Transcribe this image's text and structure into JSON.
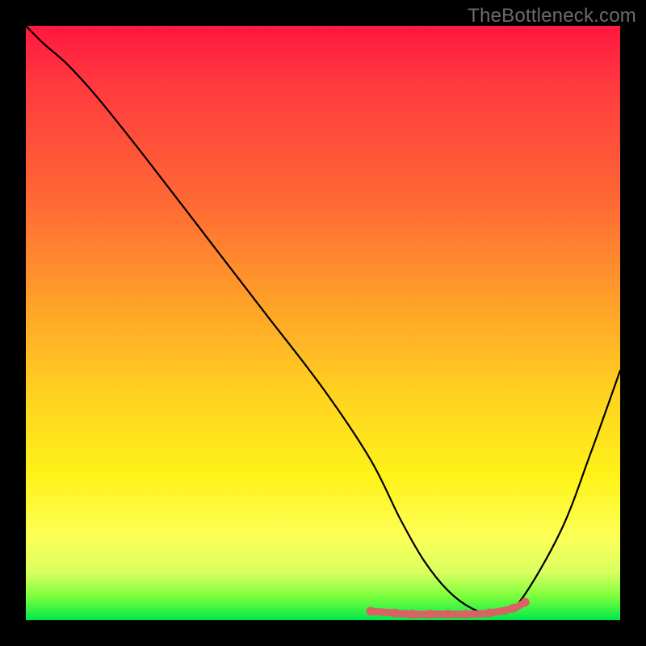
{
  "watermark": "TheBottleneck.com",
  "chart_data": {
    "type": "line",
    "title": "",
    "xlabel": "",
    "ylabel": "",
    "xlim": [
      0,
      100
    ],
    "ylim": [
      0,
      100
    ],
    "grid": false,
    "legend": false,
    "colors": {
      "gradient_top": "#ff173f",
      "gradient_bottom": "#00e84a",
      "curve": "#000000",
      "marker": "#d96262"
    },
    "series": [
      {
        "name": "bottleneck-curve",
        "x": [
          0,
          3,
          7,
          12,
          20,
          30,
          40,
          50,
          58,
          63,
          67,
          71,
          75,
          79,
          83,
          90,
          95,
          100
        ],
        "y": [
          100,
          97,
          93.5,
          88,
          78,
          65,
          52,
          39,
          27,
          17,
          10,
          5,
          2,
          1,
          3,
          15,
          28,
          42
        ]
      },
      {
        "name": "bottom-markers",
        "x": [
          58,
          62,
          65,
          68,
          71,
          74,
          78,
          82,
          84
        ],
        "y": [
          1.5,
          1.2,
          1.0,
          1.0,
          1.0,
          1.0,
          1.2,
          2.0,
          3.0
        ]
      }
    ]
  }
}
